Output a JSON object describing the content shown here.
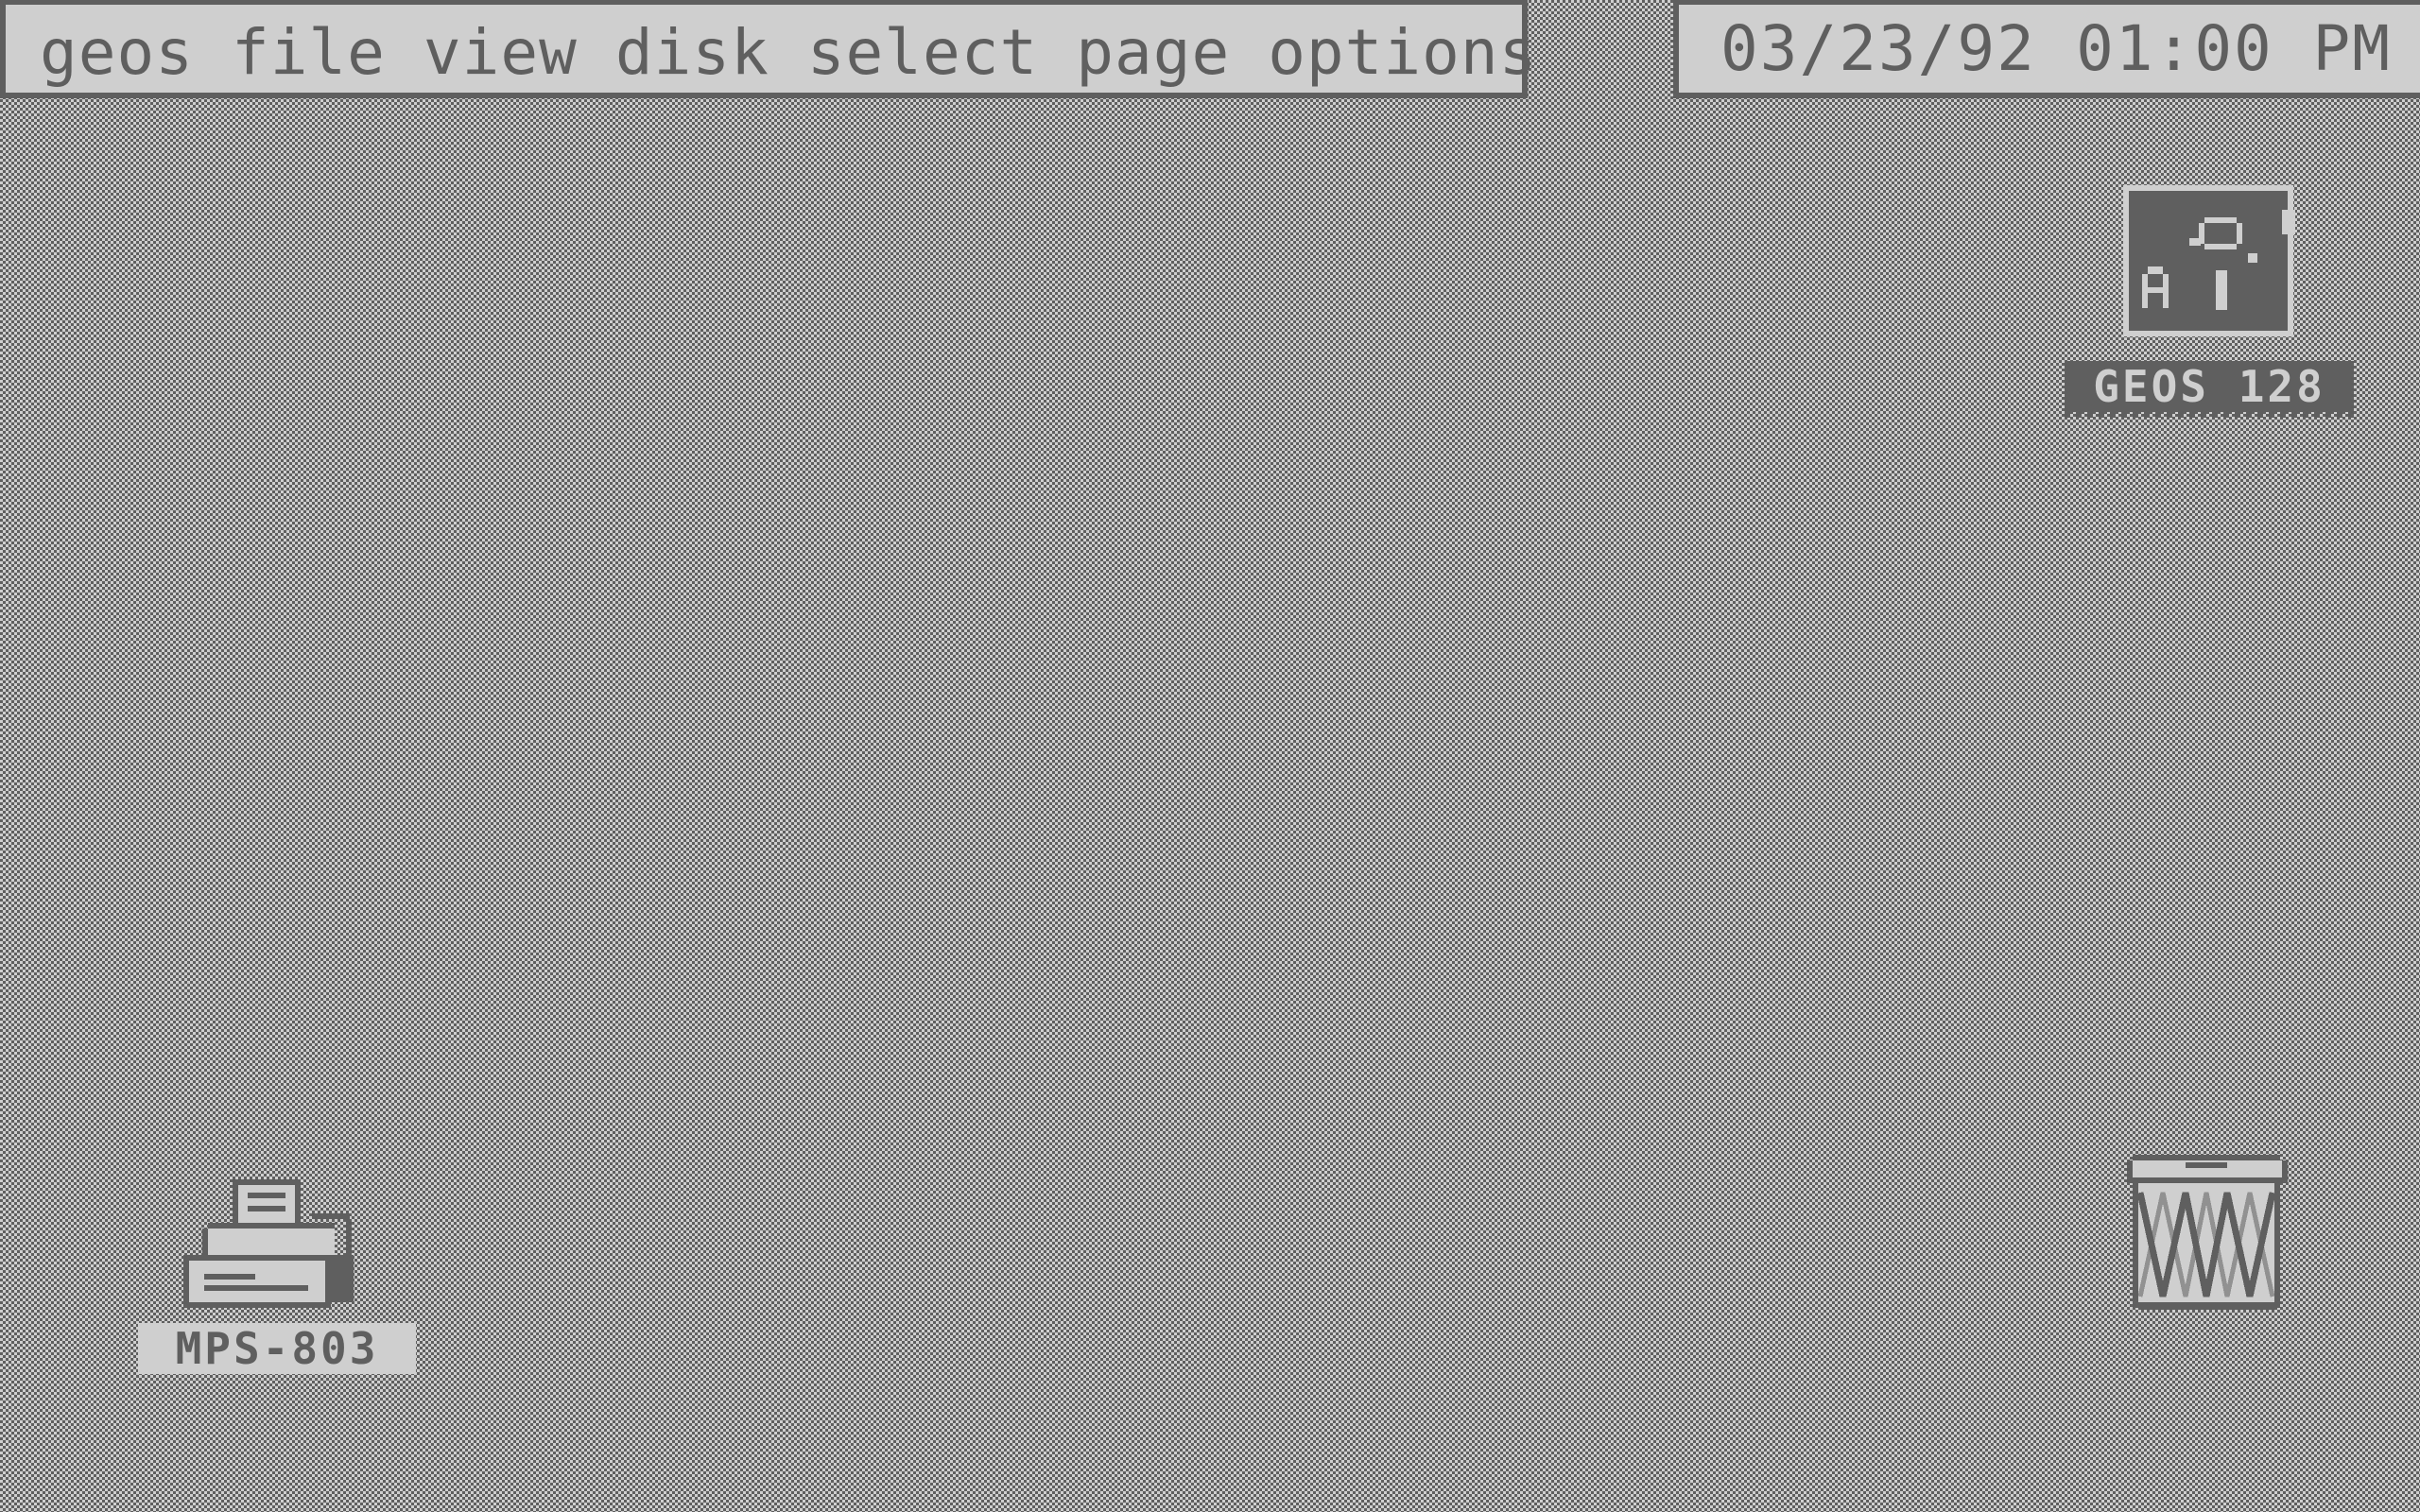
{
  "menubar": {
    "items": [
      {
        "label": "geos"
      },
      {
        "label": "file"
      },
      {
        "label": "view"
      },
      {
        "label": "disk"
      },
      {
        "label": "select"
      },
      {
        "label": "page"
      },
      {
        "label": "options"
      }
    ]
  },
  "clock": {
    "date": "03/23/92",
    "time": "01:00 PM"
  },
  "desktop": {
    "icons": [
      {
        "label": "GEOS 128",
        "icon": "geos-disk-icon",
        "selected": true
      },
      {
        "label": "MPS-803",
        "icon": "printer-icon",
        "selected": false
      },
      {
        "label": "",
        "icon": "trash-icon",
        "selected": false
      }
    ]
  },
  "colors": {
    "light": "#cfcfcf",
    "dark": "#5f5f5f"
  }
}
